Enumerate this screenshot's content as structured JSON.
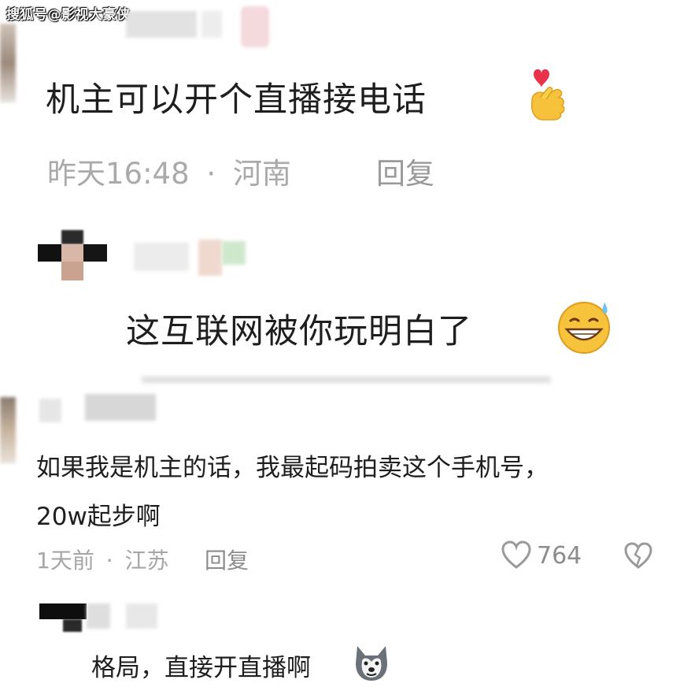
{
  "watermark": "搜狐号@影视大豪侠",
  "comments": [
    {
      "text": "机主可以开个直播接电话",
      "emoji": "finger-heart-emoji",
      "time": "昨天16:48",
      "separator": "·",
      "location": "河南",
      "reply": "回复"
    },
    {
      "text": "这互联网被你玩明白了",
      "emoji": "grinning-sweat-emoji"
    },
    {
      "text_line1": "如果我是机主的话，我最起码拍卖这个手机号，",
      "text_line2": "20w起步啊",
      "time": "1天前",
      "separator": "·",
      "location": "江苏",
      "reply": "回复",
      "likes": "764",
      "like_icon": "heart-outline-icon",
      "dislike_icon": "broken-heart-icon"
    },
    {
      "text": "格局，直接开直播啊",
      "emoji": "husky-dog-emoji"
    }
  ],
  "colors": {
    "text": "#1e1e1e",
    "meta": "#a6a6a6",
    "background": "#ffffff"
  }
}
